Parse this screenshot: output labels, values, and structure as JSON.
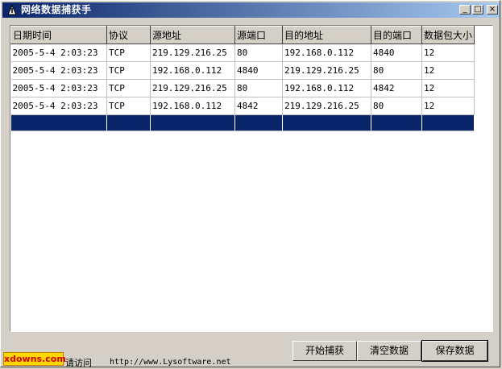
{
  "window": {
    "title": "网络数据捕获手",
    "min_glyph": "_",
    "max_glyph": "□",
    "close_glyph": "×"
  },
  "table": {
    "headers": [
      "日期时间",
      "协议",
      "源地址",
      "源端口",
      "目的地址",
      "目的端口",
      "数据包大小"
    ],
    "rows": [
      [
        "2005-5-4 2:03:23",
        "TCP",
        "219.129.216.25",
        "80",
        "192.168.0.112",
        "4840",
        "12"
      ],
      [
        "2005-5-4 2:03:23",
        "TCP",
        "192.168.0.112",
        "4840",
        "219.129.216.25",
        "80",
        "12"
      ],
      [
        "2005-5-4 2:03:23",
        "TCP",
        "219.129.216.25",
        "80",
        "192.168.0.112",
        "4842",
        "12"
      ],
      [
        "2005-5-4 2:03:23",
        "TCP",
        "192.168.0.112",
        "4842",
        "219.129.216.25",
        "80",
        "12"
      ]
    ]
  },
  "buttons": {
    "start": "开始捕获",
    "clear": "清空数据",
    "save": "保存数据"
  },
  "footer": {
    "visit_text": "请访问",
    "url": "http://www.Lysoftware.net"
  },
  "watermark": "xdowns.com",
  "colors": {
    "title_start": "#0a246a",
    "title_end": "#a6caf0",
    "selection": "#0a246a",
    "face": "#d4d0c8"
  }
}
